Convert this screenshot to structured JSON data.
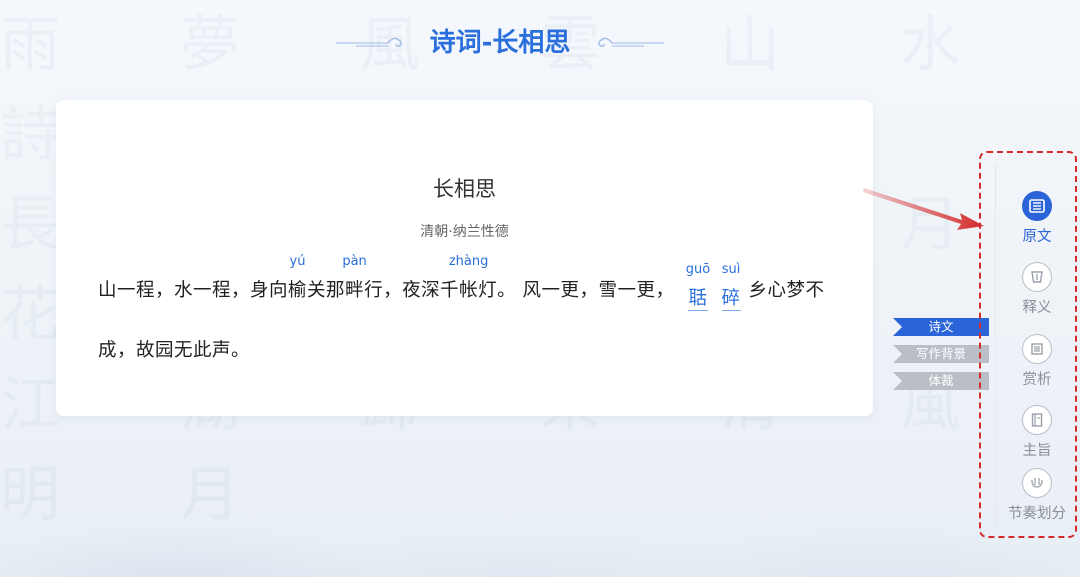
{
  "header": {
    "title": "诗词-长相思"
  },
  "poem": {
    "title": "长相思",
    "author": "清朝·纳兰性德",
    "line1": {
      "p1": "山一程，水一程，身向",
      "w1": "榆",
      "py1": "yú",
      "p2": "关那",
      "w2": "畔",
      "py2": "pàn",
      "p3": "行，夜深千",
      "w3": "帐",
      "py3": "zhàng",
      "p4": "灯。 风一更，雪一更，",
      "w4": "聒",
      "py4": "guō",
      "w5": "碎",
      "py5": "suì",
      "p5": "乡心梦不"
    },
    "line2": "成，故园无此声。"
  },
  "tags": [
    "诗文",
    "写作背景",
    "体裁"
  ],
  "sidebar": {
    "items": [
      {
        "label": "原文",
        "icon": "book-icon",
        "active": true
      },
      {
        "label": "释义",
        "icon": "cup-icon",
        "active": false
      },
      {
        "label": "赏析",
        "icon": "scroll-icon",
        "active": false
      },
      {
        "label": "主旨",
        "icon": "notebook-icon",
        "active": false
      },
      {
        "label": "节奏划分",
        "icon": "rhythm-icon",
        "active": false
      }
    ]
  },
  "colors": {
    "accent": "#2b64d8",
    "annotation": "#d42a2a",
    "inactive": "#b9bec7"
  }
}
